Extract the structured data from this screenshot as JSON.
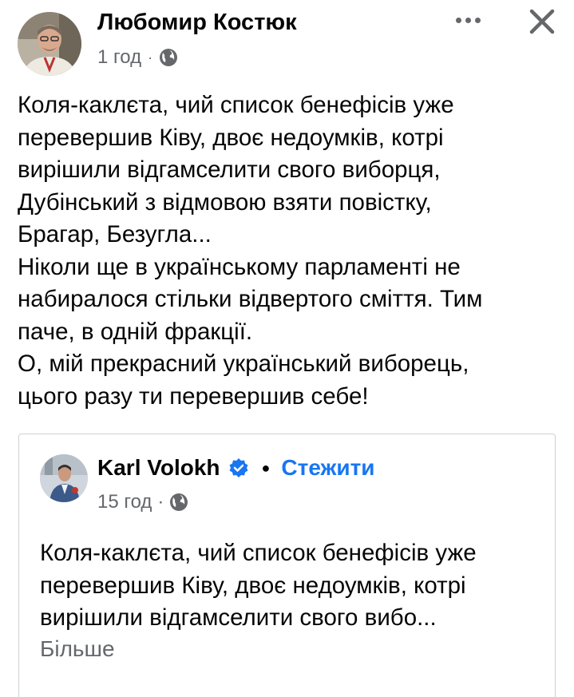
{
  "post": {
    "author": "Любомир Костюк",
    "time": "1 год",
    "text_lines": [
      "Коля-каклєта, чий список бенефісів уже",
      "перевершив Ківу, двоє недоумків, котрі",
      "вирішили відгамселити свого виборця,",
      "Дубінський з відмовою взяти повістку,",
      "Брагар, Безугла...",
      "Ніколи ще в українському парламенті не",
      "набиралося стільки  відвертого сміття. Тим",
      "паче, в одній фракції.",
      "О, мій прекрасний український виборець,",
      "цього разу ти перевершив себе!"
    ]
  },
  "shared_post": {
    "author": "Karl Volokh",
    "follow_label": "Стежити",
    "time": "15 год",
    "text_lines": [
      "Коля-каклєта, чий список бенефісів уже",
      "перевершив Ківу, двоє недоумків, котрі",
      "вирішили відгамселити свого вибо..."
    ],
    "see_more_label": "Більше"
  },
  "icons": {
    "more": "more-horizontal-icon",
    "close": "close-icon",
    "audience": "globe-icon",
    "verified": "verified-badge-icon"
  },
  "colors": {
    "text": "#050505",
    "secondary": "#65676b",
    "link": "#1876f2",
    "border": "#ced0d4"
  }
}
